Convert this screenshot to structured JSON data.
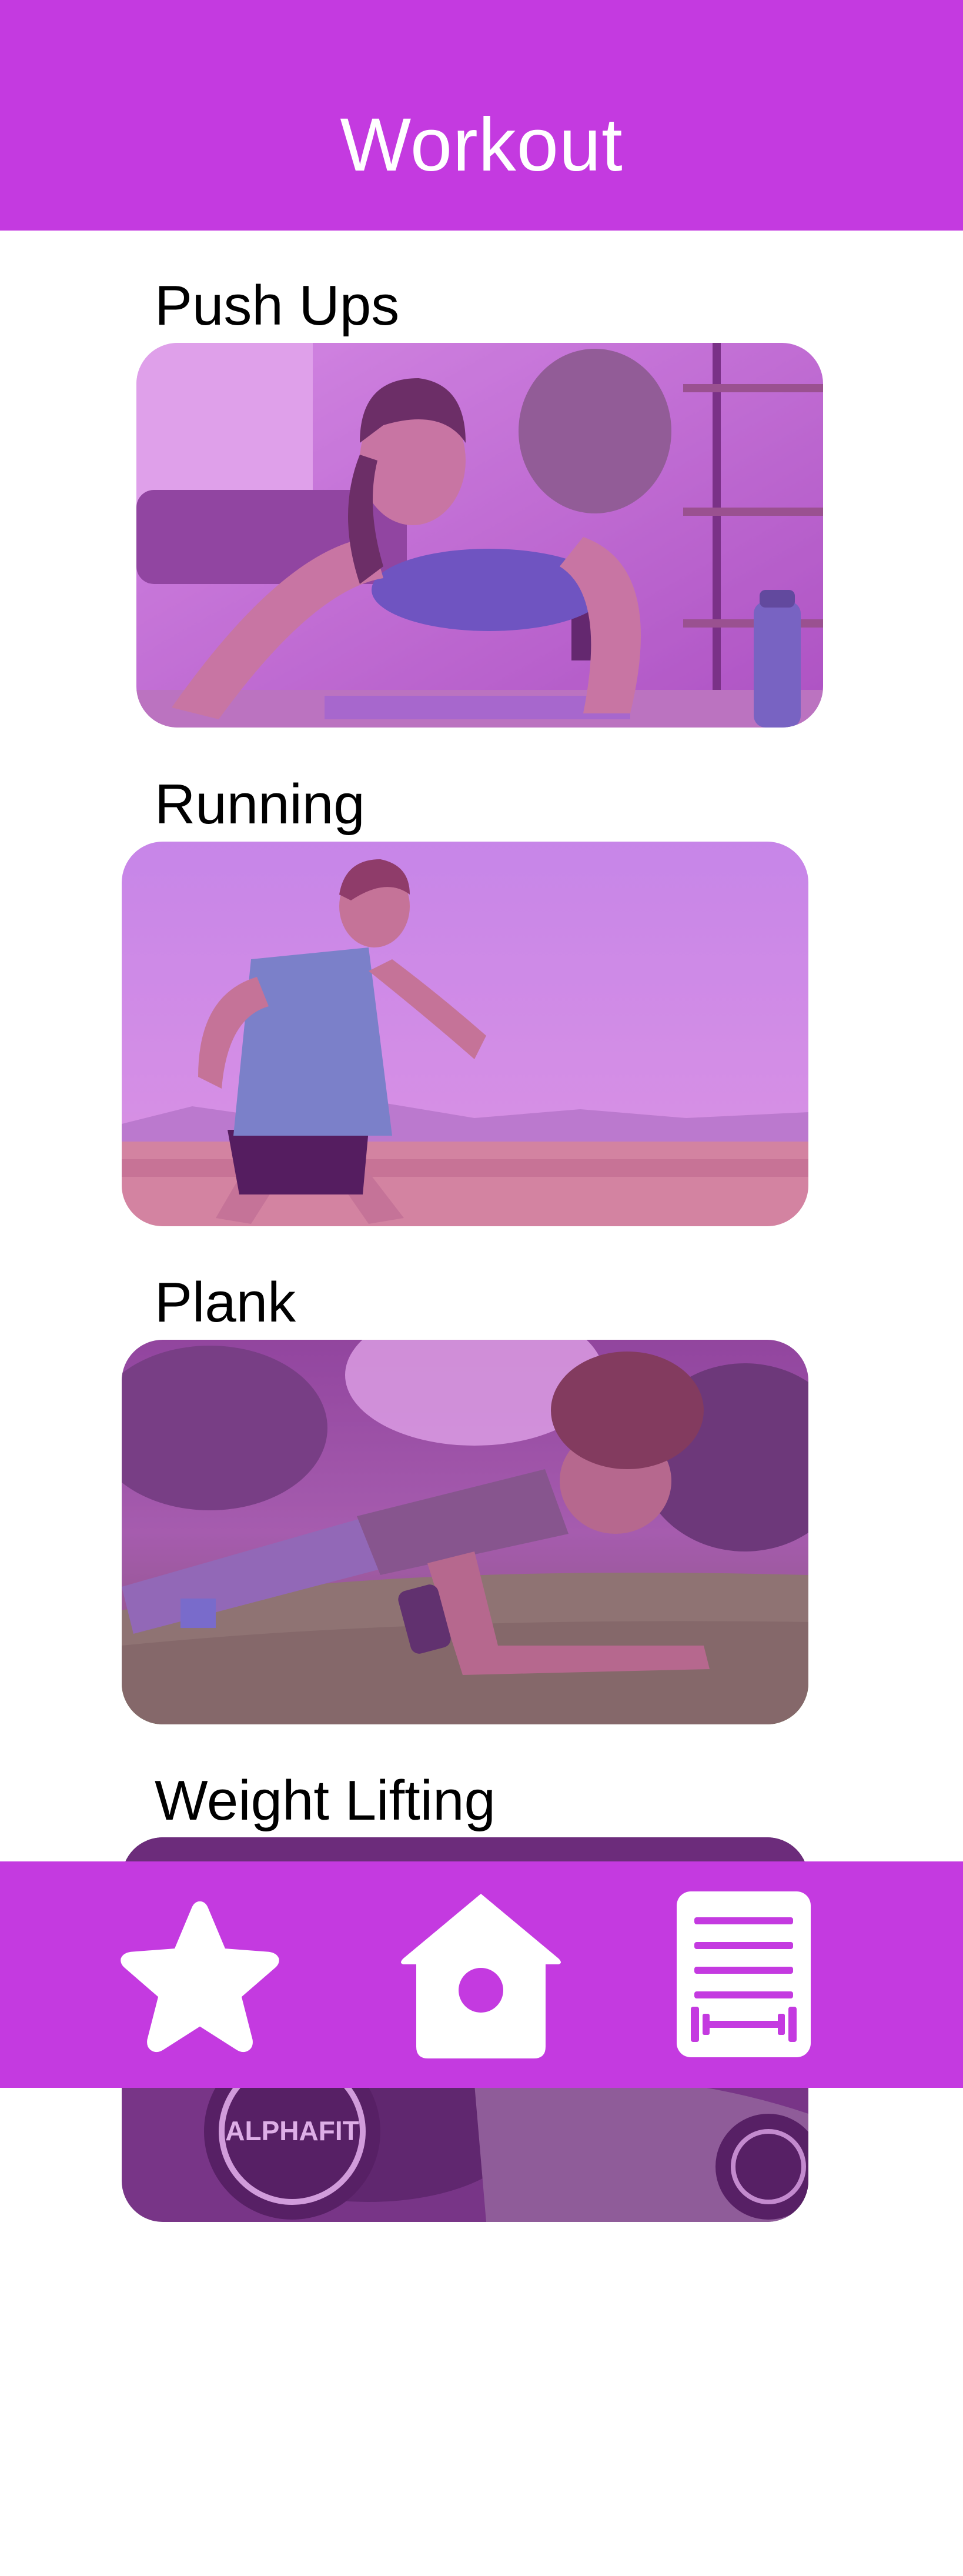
{
  "header": {
    "title": "Workout"
  },
  "workouts": [
    {
      "label": "Push Ups",
      "image": "push-ups-photo"
    },
    {
      "label": "Running",
      "image": "running-photo"
    },
    {
      "label": "Plank",
      "image": "plank-photo"
    },
    {
      "label": "Weight Lifting",
      "image": "weight-lifting-photo"
    }
  ],
  "bottom_nav": {
    "items": [
      {
        "icon": "star-icon",
        "name": "favorites"
      },
      {
        "icon": "home-icon",
        "name": "home"
      },
      {
        "icon": "workout-list-icon",
        "name": "workouts"
      }
    ]
  },
  "colors": {
    "accent": "#c43ae0",
    "header_text": "#ffffff",
    "body_text": "#000000"
  }
}
